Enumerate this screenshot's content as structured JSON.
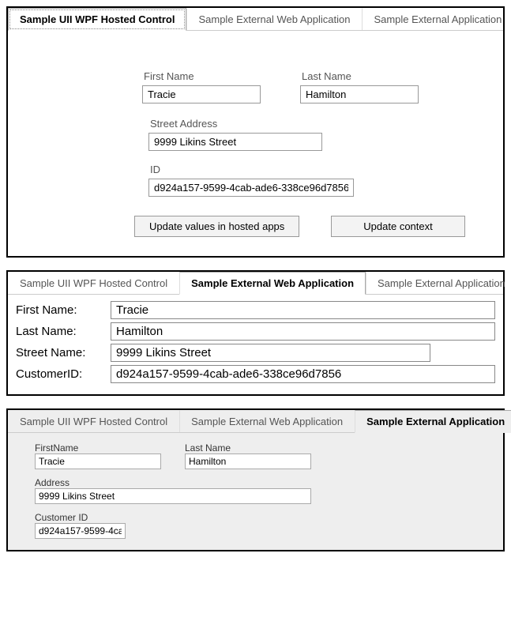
{
  "tabs": {
    "wpf": "Sample UII WPF Hosted Control",
    "web": "Sample External Web Application",
    "ext": "Sample External Application"
  },
  "panel1": {
    "labels": {
      "first_name": "First Name",
      "last_name": "Last Name",
      "street": "Street Address",
      "id": "ID"
    },
    "values": {
      "first_name": "Tracie",
      "last_name": "Hamilton",
      "street": "9999 Likins Street",
      "id": "d924a157-9599-4cab-ade6-338ce96d7856"
    },
    "buttons": {
      "update_apps": "Update values in hosted apps",
      "update_ctx": "Update context"
    }
  },
  "panel2": {
    "labels": {
      "first_name": "First Name:",
      "last_name": "Last Name:",
      "street": "Street Name:",
      "cust_id": "CustomerID:"
    },
    "values": {
      "first_name": "Tracie",
      "last_name": "Hamilton",
      "street": "9999 Likins Street",
      "cust_id": "d924a157-9599-4cab-ade6-338ce96d7856"
    }
  },
  "panel3": {
    "labels": {
      "first_name": "FirstName",
      "last_name": "Last Name",
      "address": "Address",
      "cust_id": "Customer ID"
    },
    "values": {
      "first_name": "Tracie",
      "last_name": "Hamilton",
      "address": "9999 Likins Street",
      "cust_id": "d924a157-9599-4ca"
    }
  }
}
